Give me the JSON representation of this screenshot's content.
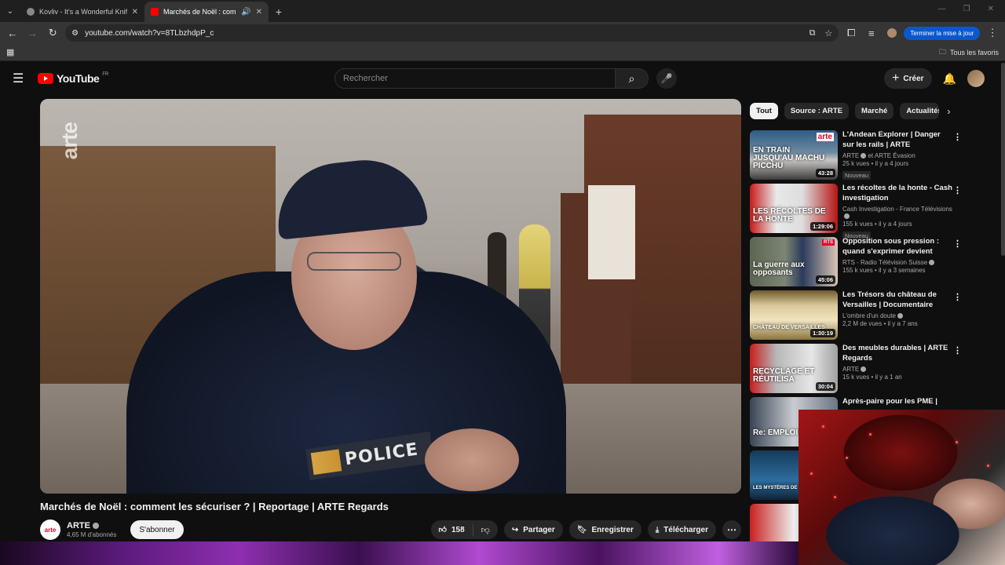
{
  "browser": {
    "tabs": [
      {
        "title": "Kovliv - It's a Wonderful Knife (",
        "active": false,
        "favicon_color": "#aaaaaa"
      },
      {
        "title": "Marchés de Noël : commen",
        "active": true,
        "favicon_color": "#ff0000"
      }
    ],
    "url": "youtube.com/watch?v=8TLbzhdpP_c",
    "update_button": "Terminer la mise à jour",
    "bookmarks_all": "Tous les favoris"
  },
  "youtube": {
    "logo": "YouTube",
    "country": "FR",
    "search_placeholder": "Rechercher",
    "create_label": "Créer"
  },
  "video": {
    "watermark": "arte",
    "badge_text": "POLICE",
    "title": "Marchés de Noël : comment les sécuriser ? | Reportage | ARTE Regards",
    "channel": {
      "name": "ARTE",
      "avatar_text": "arte",
      "subscribers": "4,65 M d'abonnés",
      "subscribe_label": "S'abonner"
    },
    "likes": "158",
    "share_label": "Partager",
    "save_label": "Enregistrer",
    "download_label": "Télécharger"
  },
  "chips": [
    {
      "label": "Tout",
      "selected": true
    },
    {
      "label": "Source : ARTE",
      "selected": false
    },
    {
      "label": "Marché",
      "selected": false
    },
    {
      "label": "Actualités p",
      "selected": false
    }
  ],
  "recommendations": [
    {
      "title": "L'Andean Explorer | Danger sur les rails | ARTE",
      "channel": "ARTE",
      "channel_suffix": "et ARTE Évasion",
      "meta": "25 k vues • il y a 4 jours",
      "badge": "Nouveau",
      "duration": "43:28",
      "thumb_caption": "EN TRAIN JUSQU'AU MACHU PICCHU",
      "thumb_logo": "arte",
      "thumb_class": "t1"
    },
    {
      "title": "Les récoltes de la honte - Cash investigation",
      "channel": "Cash Investigation - France Télévisions",
      "channel_suffix": "",
      "meta": "155 k vues • il y a 4 jours",
      "badge": "Nouveau",
      "duration": "1:29:06",
      "thumb_caption": "LES RÉCOLTES DE LA HONTE",
      "thumb_logo": "",
      "thumb_class": "t2"
    },
    {
      "title": "Opposition sous pression : quand s'exprimer devient risqu...",
      "channel": "RTS - Radio Télévision Suisse",
      "channel_suffix": "",
      "meta": "155 k vues • il y a 3 semaines",
      "badge": "",
      "duration": "45:06",
      "thumb_caption": "La guerre aux opposants",
      "thumb_logo": "RTS",
      "thumb_class": "t3"
    },
    {
      "title": "Les Trésors du château de Versailles | Documentaire",
      "channel": "L'ombre d'un doute",
      "channel_suffix": "",
      "meta": "2,2 M de vues • il y a 7 ans",
      "badge": "",
      "duration": "1:30:19",
      "thumb_caption": "CHÂTEAU DE VERSAILLES",
      "thumb_logo": "",
      "thumb_class": "t4"
    },
    {
      "title": "Des meubles durables | ARTE Regards",
      "channel": "ARTE",
      "channel_suffix": "",
      "meta": "15 k vues • il y a 1 an",
      "badge": "",
      "duration": "30:04",
      "thumb_caption": "RECYCLAGE ET RÉUTILISA",
      "thumb_logo": "",
      "thumb_class": "t5"
    },
    {
      "title": "Après-paire pour les PME |",
      "channel": "",
      "channel_suffix": "",
      "meta": "",
      "badge": "",
      "duration": "",
      "thumb_caption": "Re: EMPLOIS ME",
      "thumb_logo": "",
      "thumb_class": "t6"
    },
    {
      "title": "",
      "channel": "",
      "channel_suffix": "",
      "meta": "",
      "badge": "",
      "duration": "",
      "thumb_caption": "LES MYSTÈRES DE",
      "thumb_logo": "",
      "thumb_class": "t7"
    },
    {
      "title": "",
      "channel": "",
      "channel_suffix": "",
      "meta": "",
      "badge": "",
      "duration": "",
      "thumb_caption": "",
      "thumb_logo": "",
      "thumb_class": "t8"
    }
  ]
}
